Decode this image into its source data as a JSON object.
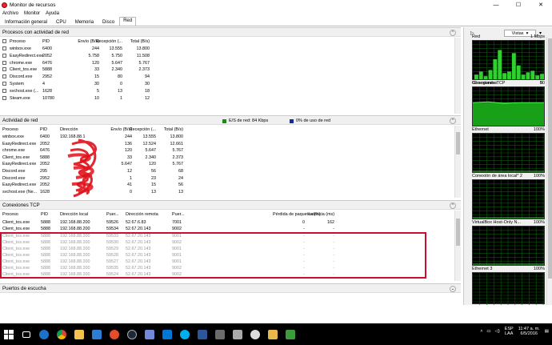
{
  "window": {
    "title": "Monitor de recursos",
    "minimize": "—",
    "maximize": "☐",
    "close": "✕"
  },
  "menu": [
    "Archivo",
    "Monitor",
    "Ayuda"
  ],
  "tabs": [
    "Información general",
    "CPU",
    "Memoria",
    "Disco",
    "Red"
  ],
  "active_tab": "Red",
  "processes": {
    "title": "Procesos con actividad de red",
    "columns": [
      "Proceso",
      "PID",
      "Envío (B/s)",
      "Recepción (...",
      "Total (B/s)"
    ],
    "rows": [
      [
        "winbox.exe",
        "6400",
        "244",
        "13.555",
        "13.800"
      ],
      [
        "EasyRedirect.exe",
        "2052",
        "5.758",
        "5.750",
        "11.508"
      ],
      [
        "chrome.exe",
        "6476",
        "120",
        "5.647",
        "5.767"
      ],
      [
        "Client_tos.exe",
        "5888",
        "33",
        "2.340",
        "2.373"
      ],
      [
        "Discord.exe",
        "2952",
        "15",
        "80",
        "94"
      ],
      [
        "System",
        "4",
        "30",
        "0",
        "30"
      ],
      [
        "svchost.exe (...",
        "1628",
        "5",
        "13",
        "18"
      ],
      [
        "Steam.exe",
        "10780",
        "10",
        "1",
        "12"
      ]
    ]
  },
  "activity": {
    "title": "Actividad de red",
    "legend1": "E/S de red: 84 Kbps",
    "legend2": "0% de uso de red",
    "legend1_color": "#1a8a1a",
    "legend2_color": "#1a2a9a",
    "columns": [
      "Proceso",
      "PID",
      "Dirección",
      "Envío (B/s)",
      "Recepción (...",
      "Total (B/s)"
    ],
    "rows": [
      [
        "winbox.exe",
        "6400",
        "192.168.88.1",
        "244",
        "13.555",
        "13.800"
      ],
      [
        "EasyRedirect.exe",
        "2052",
        "",
        "136",
        "12.524",
        "12.661"
      ],
      [
        "chrome.exe",
        "6476",
        "",
        "120",
        "5.647",
        "5.767"
      ],
      [
        "Client_tos.exe",
        "5888",
        "",
        "33",
        "2.340",
        "2.373"
      ],
      [
        "EasyRedirect.exe",
        "2052",
        "",
        "5.647",
        "120",
        "5.767"
      ],
      [
        "Discord.exe",
        "295",
        "",
        "12",
        "56",
        "68"
      ],
      [
        "Discord.exe",
        "2952",
        "",
        "1",
        "23",
        "24"
      ],
      [
        "EasyRedirect.exe",
        "2052",
        "",
        "41",
        "15",
        "56"
      ],
      [
        "svchost.exe (Ne...",
        "1628",
        "",
        "0",
        "13",
        "13"
      ]
    ]
  },
  "tcp": {
    "title": "Conexiones TCP",
    "columns": [
      "Proceso",
      "PID",
      "Dirección local",
      "Puer...",
      "Dirección remota",
      "Puer...",
      "Pérdida de paquetes (%)",
      "Latencia (ms)"
    ],
    "rows": [
      [
        "Client_tos.exe",
        "5888",
        "192.168.88.200",
        "59526",
        "52.67.6.83",
        "7001",
        "0",
        "162"
      ],
      [
        "Client_tos.exe",
        "5888",
        "192.168.88.200",
        "59534",
        "52.67.20.143",
        "9002",
        "-",
        "-"
      ]
    ],
    "grey_rows": [
      [
        "Client_tos.exe",
        "5888",
        "192.168.88.200",
        "59533",
        "52.67.20.143",
        "9001",
        "-",
        "-"
      ],
      [
        "Client_tos.exe",
        "5888",
        "192.168.88.200",
        "59530",
        "52.67.20.143",
        "9002",
        "-",
        "-"
      ],
      [
        "Client_tos.exe",
        "5888",
        "192.168.88.200",
        "59529",
        "52.67.20.143",
        "9001",
        "-",
        "-"
      ],
      [
        "Client_tos.exe",
        "5888",
        "192.168.88.200",
        "59528",
        "52.67.20.143",
        "9001",
        "-",
        "-"
      ],
      [
        "Client_tos.exe",
        "5888",
        "192.168.88.200",
        "59527",
        "52.67.20.143",
        "9001",
        "-",
        "-"
      ],
      [
        "Client_tos.exe",
        "5888",
        "192.168.88.200",
        "59535",
        "52.67.20.143",
        "9002",
        "-",
        "-"
      ],
      [
        "Client_tos.exe",
        "5888",
        "192.168.88.200",
        "59524",
        "52.67.20.143",
        "9002",
        "-",
        "-"
      ]
    ]
  },
  "listen": {
    "title": "Puertos de escucha"
  },
  "side": {
    "views_label": "Vistas",
    "graphs": [
      {
        "name": "Red",
        "max": "1 Mbps",
        "footer_left": "60 segundos",
        "footer_right": "0"
      },
      {
        "name": "Conexiones TCP",
        "max": "50",
        "footer_left": "",
        "footer_right": ""
      },
      {
        "name": "Ethernet",
        "max": "100%",
        "footer_left": "",
        "footer_right": ""
      },
      {
        "name": "Conexión de área local* 2",
        "max": "100%",
        "footer_left": "",
        "footer_right": ""
      },
      {
        "name": "VirtualBox Host-Only N...",
        "max": "100%",
        "footer_left": "",
        "footer_right": ""
      },
      {
        "name": "Ethernet 3",
        "max": "100%",
        "footer_left": "",
        "footer_right": ""
      }
    ]
  },
  "taskbar": {
    "lang": "ESP",
    "lang2": "LAA",
    "time": "11:47 a. m.",
    "date": "6/5/2016"
  }
}
